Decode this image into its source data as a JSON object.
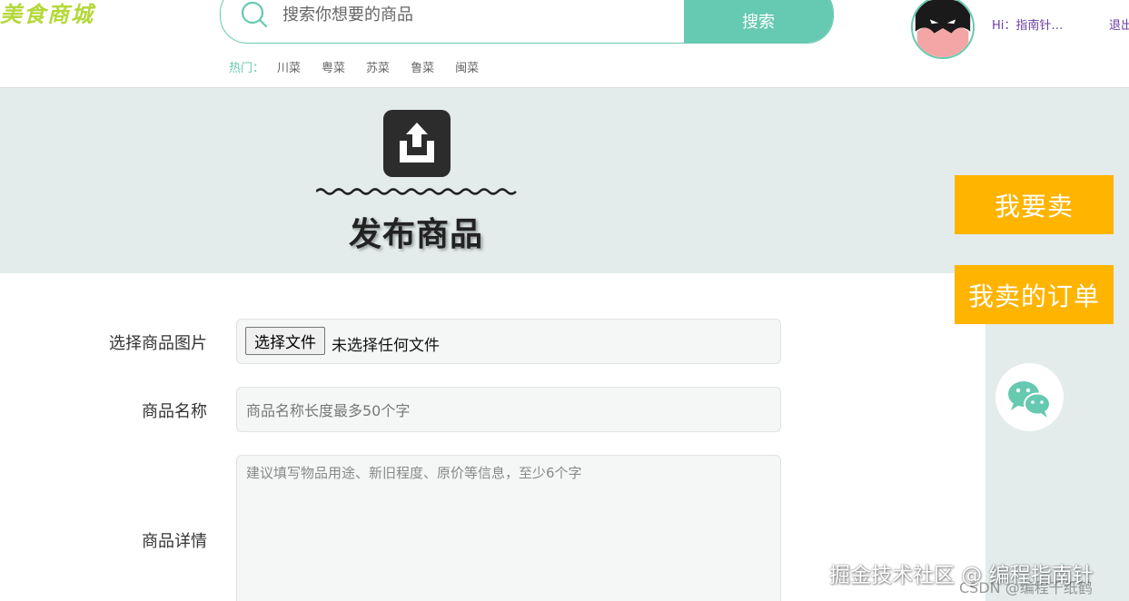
{
  "header": {
    "logo_text": "美食商城",
    "search": {
      "placeholder": "搜索你想要的商品",
      "button_label": "搜索"
    },
    "hot": {
      "label": "热门：",
      "items": [
        "川菜",
        "粤菜",
        "苏菜",
        "鲁菜",
        "闽菜"
      ]
    },
    "user": {
      "greeting": "Hi：指南针…",
      "logout_label": "退出"
    }
  },
  "banner": {
    "title": "发布商品",
    "icon": "upload-icon"
  },
  "sidebar": {
    "sell_label": "我要卖",
    "orders_label": "我卖的订单",
    "wechat_icon": "wechat-icon"
  },
  "form": {
    "image_label": "选择商品图片",
    "file_button_label": "选择文件",
    "file_status": "未选择任何文件",
    "name_label": "商品名称",
    "name_placeholder": "商品名称长度最多50个字",
    "detail_label": "商品详情",
    "detail_placeholder": "建议填写物品用途、新旧程度、原价等信息，至少6个字"
  },
  "watermark": {
    "main": "掘金技术社区 @ 编程指南针",
    "sub": "CSDN @编程千纸鹤"
  },
  "colors": {
    "accent": "#66c9b1",
    "sidebar_button": "#ffb400",
    "banner_bg": "#e3ebeb",
    "user_text": "#6b3fa0"
  }
}
